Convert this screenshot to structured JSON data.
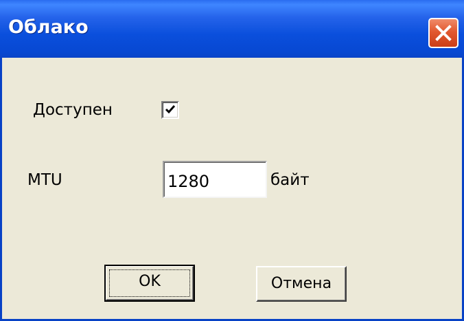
{
  "window": {
    "title": "Облако",
    "title_bar_color": "#0a4fdc",
    "close_button_color": "#e2582f",
    "close_icon": "close-icon"
  },
  "form": {
    "available_label": "Доступен",
    "available_checked": true,
    "mtu_label": "MTU",
    "mtu_value": "1280",
    "mtu_unit": "байт"
  },
  "buttons": {
    "ok_label": "OK",
    "cancel_label": "Отмена"
  }
}
